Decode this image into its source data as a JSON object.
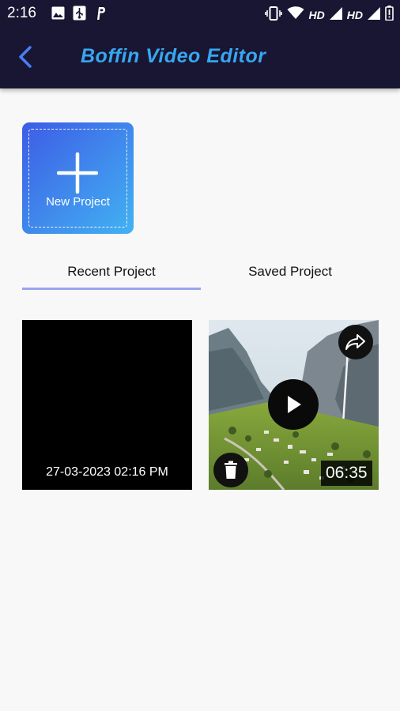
{
  "status_bar": {
    "time": "2:16",
    "left_icons": [
      "image-icon",
      "usb-icon",
      "p-app-icon"
    ],
    "right_icons": [
      "vibrate-icon",
      "wifi-icon",
      "signal-icon",
      "signal-icon",
      "battery-icon"
    ],
    "hd_label_1": "HD",
    "hd_label_2": "HD"
  },
  "app_bar": {
    "title": "Boffin Video Editor",
    "back_icon": "back-arrow-icon"
  },
  "new_project": {
    "label": "New Project",
    "icon": "plus-icon"
  },
  "tabs": [
    {
      "label": "Recent Project",
      "selected": true
    },
    {
      "label": "Saved Project",
      "selected": false
    }
  ],
  "projects": [
    {
      "date": "27-03-2023 02:16 PM"
    },
    {
      "duration": "06:35",
      "icons": [
        "share-icon",
        "play-icon",
        "delete-icon"
      ]
    }
  ],
  "colors": {
    "bar_bg": "#181632",
    "title": "#38a6f0",
    "tab_indicator": "#9aa5ef",
    "gradient_start": "#3d5ce6",
    "gradient_end": "#42b2f2"
  }
}
